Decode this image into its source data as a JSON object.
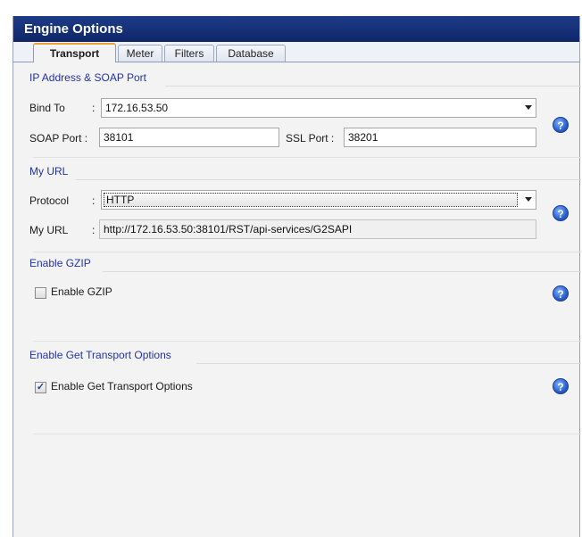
{
  "window": {
    "title": "Engine Options"
  },
  "tabs": [
    "Transport",
    "Meter",
    "Filters",
    "Database"
  ],
  "ip_section": {
    "title": "IP Address & SOAP Port",
    "bind_to_label": "Bind To",
    "colon": ":",
    "bind_to_value": "172.16.53.50",
    "soap_port_label": "SOAP Port :",
    "soap_port_value": "38101",
    "ssl_port_label": "SSL Port :",
    "ssl_port_value": "38201"
  },
  "url_section": {
    "title": "My URL",
    "protocol_label": "Protocol",
    "protocol_value": "HTTP",
    "my_url_label": "My URL",
    "my_url_value": "http://172.16.53.50:38101/RST/api-services/G2SAPI"
  },
  "gzip_section": {
    "title": "Enable GZIP",
    "checkbox_label": "Enable GZIP",
    "checked": false
  },
  "transport_section": {
    "title": "Enable Get Transport Options",
    "checkbox_label": "Enable Get Transport Options",
    "checked": true,
    "check_mark": "✓"
  },
  "help_glyph": "?",
  "icons": [
    "help-icon",
    "dropdown-arrow-icon",
    "checkbox-icon"
  ],
  "colors": {
    "title_bar": "#10266a",
    "section_title": "#2233aa",
    "active_tab_accent": "#f0a030"
  }
}
